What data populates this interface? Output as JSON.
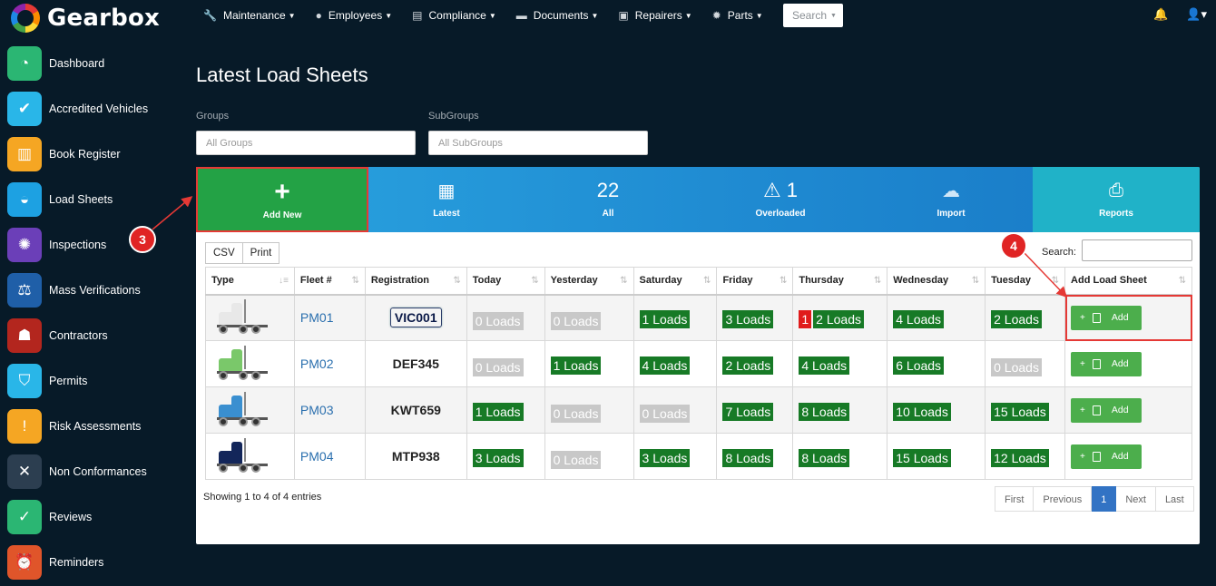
{
  "brand": {
    "name": "Gearbox"
  },
  "nav": [
    {
      "label": "Maintenance",
      "icon": "wrench-icon",
      "glyph": "🔧"
    },
    {
      "label": "Employees",
      "icon": "user-circle-icon",
      "glyph": "●"
    },
    {
      "label": "Compliance",
      "icon": "clipboard-icon",
      "glyph": "▤"
    },
    {
      "label": "Documents",
      "icon": "folder-icon",
      "glyph": "▬"
    },
    {
      "label": "Repairers",
      "icon": "id-card-icon",
      "glyph": "▣"
    },
    {
      "label": "Parts",
      "icon": "gear-icon",
      "glyph": "✹"
    }
  ],
  "search_menu": "Search",
  "sidebar": [
    {
      "label": "Dashboard",
      "icon": "gauge-icon",
      "color": "#2bb673",
      "glyph": "◔"
    },
    {
      "label": "Accredited Vehicles",
      "icon": "double-check-icon",
      "color": "#29b6e8",
      "glyph": "✔"
    },
    {
      "label": "Book Register",
      "icon": "books-icon",
      "color": "#f5a623",
      "glyph": "▥"
    },
    {
      "label": "Load Sheets",
      "icon": "bag-icon",
      "color": "#1da1e2",
      "glyph": "◒"
    },
    {
      "label": "Inspections",
      "icon": "badge-icon",
      "color": "#6b3fb8",
      "glyph": "✺"
    },
    {
      "label": "Mass Verifications",
      "icon": "scales-icon",
      "color": "#1f5fa8",
      "glyph": "⚖"
    },
    {
      "label": "Contractors",
      "icon": "worker-icon",
      "color": "#b3261e",
      "glyph": "☗"
    },
    {
      "label": "Permits",
      "icon": "shield-check-icon",
      "color": "#29b6e8",
      "glyph": "⛉"
    },
    {
      "label": "Risk Assessments",
      "icon": "warning-file-icon",
      "color": "#f5a623",
      "glyph": "!"
    },
    {
      "label": "Non Conformances",
      "icon": "x-icon",
      "color": "#2c3e50",
      "glyph": "✕"
    },
    {
      "label": "Reviews",
      "icon": "clipboard-check-icon",
      "color": "#2bb673",
      "glyph": "✓"
    },
    {
      "label": "Reminders",
      "icon": "alarm-clock-icon",
      "color": "#e0552a",
      "glyph": "⏰"
    }
  ],
  "page": {
    "title": "Latest Load Sheets",
    "groups_label": "Groups",
    "groups_placeholder": "All Groups",
    "subgroups_label": "SubGroups",
    "subgroups_placeholder": "All SubGroups"
  },
  "stats": {
    "add_new": "Add New",
    "latest": "Latest",
    "all_count": "22",
    "all": "All",
    "overloaded_count": "1",
    "overloaded": "Overloaded",
    "import": "Import",
    "reports": "Reports"
  },
  "toolbar": {
    "csv": "CSV",
    "print": "Print",
    "search_label": "Search:"
  },
  "table": {
    "headers": [
      "Type",
      "Fleet #",
      "Registration",
      "Today",
      "Yesterday",
      "Saturday",
      "Friday",
      "Thursday",
      "Wednesday",
      "Tuesday",
      "Add Load Sheet"
    ],
    "add_label": "Add",
    "rows": [
      {
        "fleet": "PM01",
        "reg": "VIC001",
        "truck_color": "#e8e8e8",
        "today": "0 Loads",
        "yesterday": "0 Loads",
        "saturday": "1 Loads",
        "friday": "3 Loads",
        "thursday_flag": "1",
        "thursday": "2 Loads",
        "wednesday": "4 Loads",
        "tuesday": "2 Loads"
      },
      {
        "fleet": "PM02",
        "reg": "DEF345",
        "truck_color": "#7ac86a",
        "today": "0 Loads",
        "yesterday": "1 Loads",
        "saturday": "4 Loads",
        "friday": "2 Loads",
        "thursday_flag": "",
        "thursday": "4 Loads",
        "wednesday": "6 Loads",
        "tuesday": "0 Loads"
      },
      {
        "fleet": "PM03",
        "reg": "KWT659",
        "truck_color": "#3a8fd0",
        "today": "1 Loads",
        "yesterday": "0 Loads",
        "saturday": "0 Loads",
        "friday": "7 Loads",
        "thursday_flag": "",
        "thursday": "8 Loads",
        "wednesday": "10 Loads",
        "tuesday": "15 Loads"
      },
      {
        "fleet": "PM04",
        "reg": "MTP938",
        "truck_color": "#13265a",
        "today": "3 Loads",
        "yesterday": "0 Loads",
        "saturday": "3 Loads",
        "friday": "8 Loads",
        "thursday_flag": "",
        "thursday": "8 Loads",
        "wednesday": "15 Loads",
        "tuesday": "12 Loads"
      }
    ]
  },
  "footer": {
    "showing": "Showing 1 to 4 of 4 entries"
  },
  "pager": [
    "First",
    "Previous",
    "1",
    "Next",
    "Last"
  ],
  "annotations": {
    "step3": "3",
    "step4": "4"
  }
}
